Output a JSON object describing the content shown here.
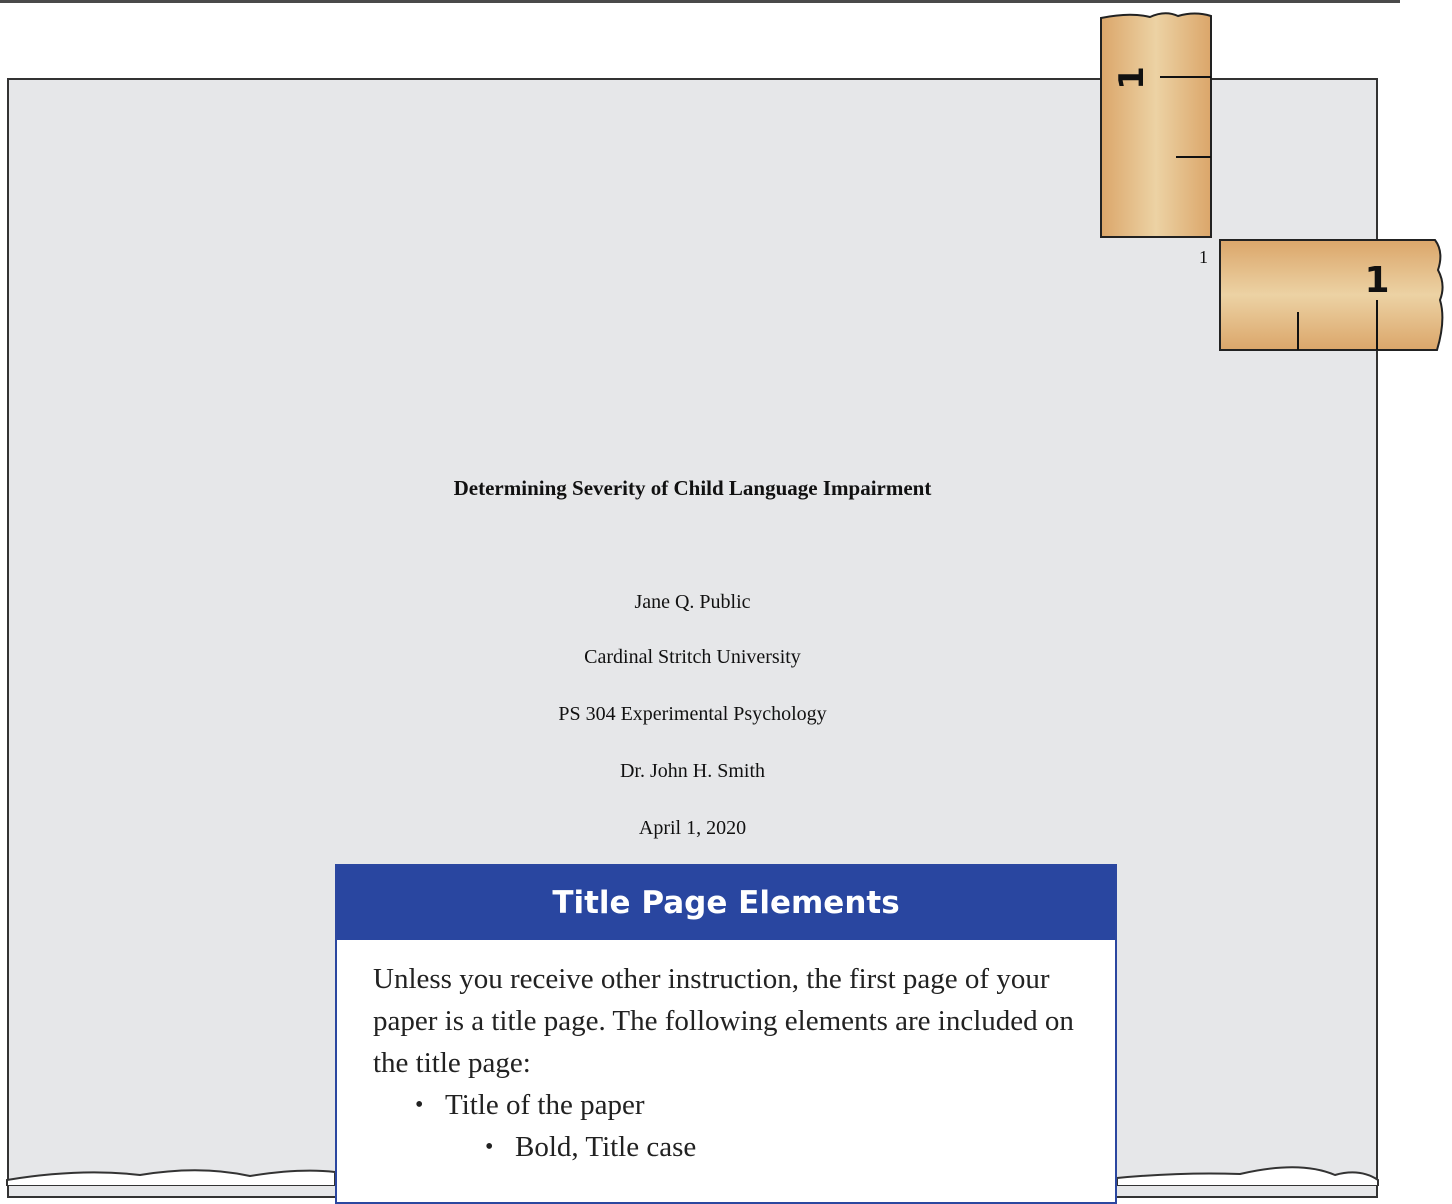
{
  "page_number": "1",
  "ruler_vertical": {
    "label": "1"
  },
  "ruler_horizontal": {
    "label": "1"
  },
  "title_page": {
    "title": "Determining Severity of Child Language Impairment",
    "author": "Jane Q. Public",
    "institution": "Cardinal Stritch University",
    "course": "PS 304 Experimental Psychology",
    "instructor": "Dr. John H. Smith",
    "date": "April 1, 2020"
  },
  "callout": {
    "heading": "Title Page Elements",
    "intro": "Unless you receive other instruction, the first page of your paper is a title page.  The following elements are included on the title page:",
    "items": [
      {
        "label": "Title of the paper",
        "sub": [
          "Bold, Title case"
        ]
      }
    ]
  }
}
